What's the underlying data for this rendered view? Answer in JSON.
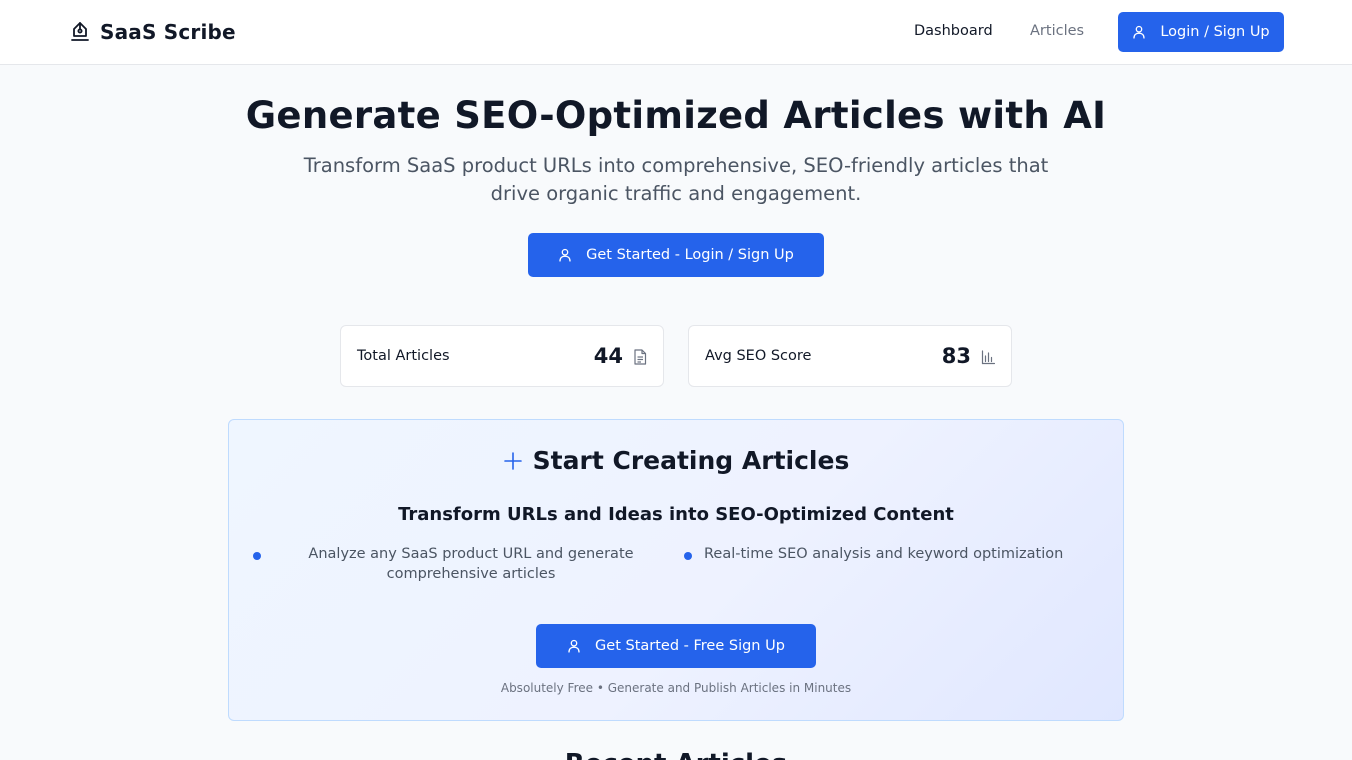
{
  "header": {
    "brand_name": "SaaS Scribe",
    "brand_icon": "pen-nib-icon",
    "nav": [
      {
        "label": "Dashboard",
        "active": true
      },
      {
        "label": "Articles",
        "active": false
      }
    ],
    "login_label": "Login / Sign Up",
    "login_icon": "user-icon"
  },
  "hero": {
    "title": "Generate SEO-Optimized Articles with AI",
    "subtitle": "Transform SaaS product URLs into comprehensive, SEO-friendly articles that drive organic traffic and engagement.",
    "cta_label": "Get Started - Login / Sign Up"
  },
  "stats": [
    {
      "label": "Total Articles",
      "value": "44",
      "icon": "document-icon"
    },
    {
      "label": "Avg SEO Score",
      "value": "83",
      "icon": "bar-chart-icon"
    }
  ],
  "create": {
    "title": "Start Creating Articles",
    "subtitle": "Transform URLs and Ideas into SEO-Optimized Content",
    "features": [
      "Analyze any SaaS product URL and generate comprehensive articles",
      "Real-time SEO analysis and keyword optimization"
    ],
    "cta_label": "Get Started - Free Sign Up",
    "note": "Absolutely Free • Generate and Publish Articles in Minutes"
  },
  "next_section": {
    "title": "Recent Articles"
  },
  "colors": {
    "primary": "#2563eb",
    "background": "#f8fafc",
    "panel_border": "#bfdbfe"
  }
}
